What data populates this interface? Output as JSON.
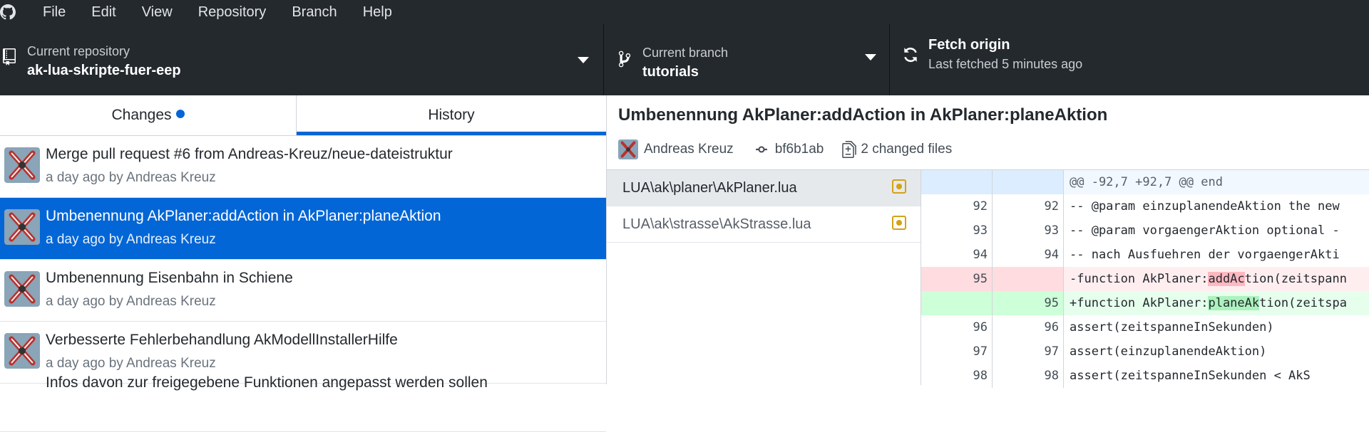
{
  "menu": {
    "items": [
      "File",
      "Edit",
      "View",
      "Repository",
      "Branch",
      "Help"
    ]
  },
  "toolbar": {
    "repo_label": "Current repository",
    "repo_name": "ak-lua-skripte-fuer-eep",
    "branch_label": "Current branch",
    "branch_name": "tutorials",
    "fetch_title": "Fetch origin",
    "fetch_sub": "Last fetched 5 minutes ago"
  },
  "tabs": {
    "changes": "Changes",
    "history": "History"
  },
  "commits": [
    {
      "title": "Merge pull request #6 from Andreas-Kreuz/neue-dateistruktur",
      "meta": "a day ago by Andreas Kreuz"
    },
    {
      "title": "Umbenennung AkPlaner:addAction in AkPlaner:planeAktion",
      "meta": "a day ago by Andreas Kreuz"
    },
    {
      "title": "Umbenennung Eisenbahn in Schiene",
      "meta": "a day ago by Andreas Kreuz"
    },
    {
      "title": "Verbesserte Fehlerbehandlung AkModellInstallerHilfe",
      "meta": "a day ago by Andreas Kreuz"
    },
    {
      "title": "Infos davon zur freigegebene Funktionen angepasst werden sollen",
      "meta": ""
    }
  ],
  "selected_commit": {
    "title": "Umbenennung AkPlaner:addAction in AkPlaner:planeAktion",
    "author": "Andreas Kreuz",
    "sha": "bf6b1ab",
    "changed_files": "2 changed files"
  },
  "files": [
    {
      "path": "LUA\\ak\\planer\\AkPlaner.lua"
    },
    {
      "path": "LUA\\ak\\strasse\\AkStrasse.lua"
    }
  ],
  "diff": {
    "hunk": "@@ -92,7 +92,7 @@ end",
    "lines": [
      {
        "old": "92",
        "new": "92",
        "code": " -- @param einzuplanendeAktion the new"
      },
      {
        "old": "93",
        "new": "93",
        "code": " -- @param vorgaengerAktion optional -"
      },
      {
        "old": "94",
        "new": "94",
        "code": " -- nach Ausfuehren der vorgaengerAkti"
      },
      {
        "old": "95",
        "new": "",
        "pre": "-function AkPlaner:",
        "hl": "addAc",
        "post": "tion(zeitspann"
      },
      {
        "old": "",
        "new": "95",
        "pre": "+function AkPlaner:",
        "hl": "planeAk",
        "post": "tion(zeitspa"
      },
      {
        "old": "96",
        "new": "96",
        "code": "     assert(zeitspanneInSekunden)"
      },
      {
        "old": "97",
        "new": "97",
        "code": "     assert(einzuplanendeAktion)"
      },
      {
        "old": "98",
        "new": "98",
        "code": "     assert(zeitspanneInSekunden < AkS"
      }
    ]
  },
  "colors": {
    "toolbar_bg": "#24292e",
    "accent": "#0366d6",
    "modified_badge": "#d4a215",
    "deleted_bg": "#ffeef0",
    "added_bg": "#e6ffed"
  },
  "icons": [
    "github-logo-icon",
    "repository-icon",
    "branch-icon",
    "sync-icon",
    "commit-icon",
    "file-diff-icon",
    "modified-file-icon"
  ]
}
